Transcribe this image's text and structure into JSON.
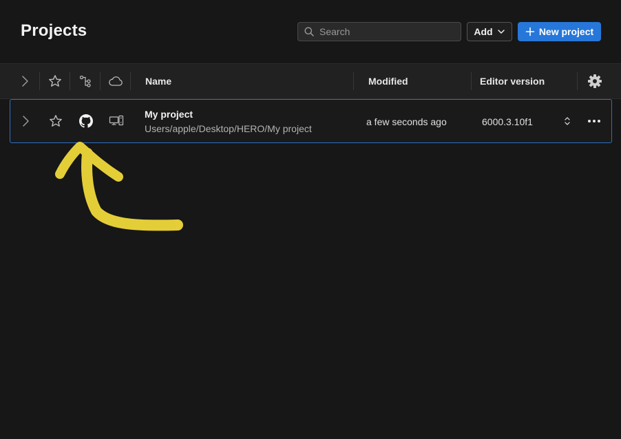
{
  "header": {
    "title": "Projects",
    "search_placeholder": "Search",
    "add_label": "Add",
    "new_project_label": "New project"
  },
  "table": {
    "columns": {
      "name": "Name",
      "modified": "Modified",
      "editor_version": "Editor version"
    },
    "header_icons": [
      "chevron-right-icon",
      "star-icon",
      "branch-icon",
      "cloud-icon",
      "gear-icon"
    ],
    "rows": [
      {
        "name": "My project",
        "path": "Users/apple/Desktop/HERO/My project",
        "modified": "a few seconds ago",
        "editor_version": "6000.3.10f1",
        "icons": [
          "chevron-right-icon",
          "star-icon",
          "github-icon",
          "computer-icon",
          "updown-chevron-icon",
          "more-icon"
        ],
        "selected": true
      }
    ]
  },
  "colors": {
    "background": "#171717",
    "header_bg": "#212121",
    "accent": "#2677d9",
    "selection_border": "#2f6fc4",
    "annotation": "#f0d83a"
  }
}
